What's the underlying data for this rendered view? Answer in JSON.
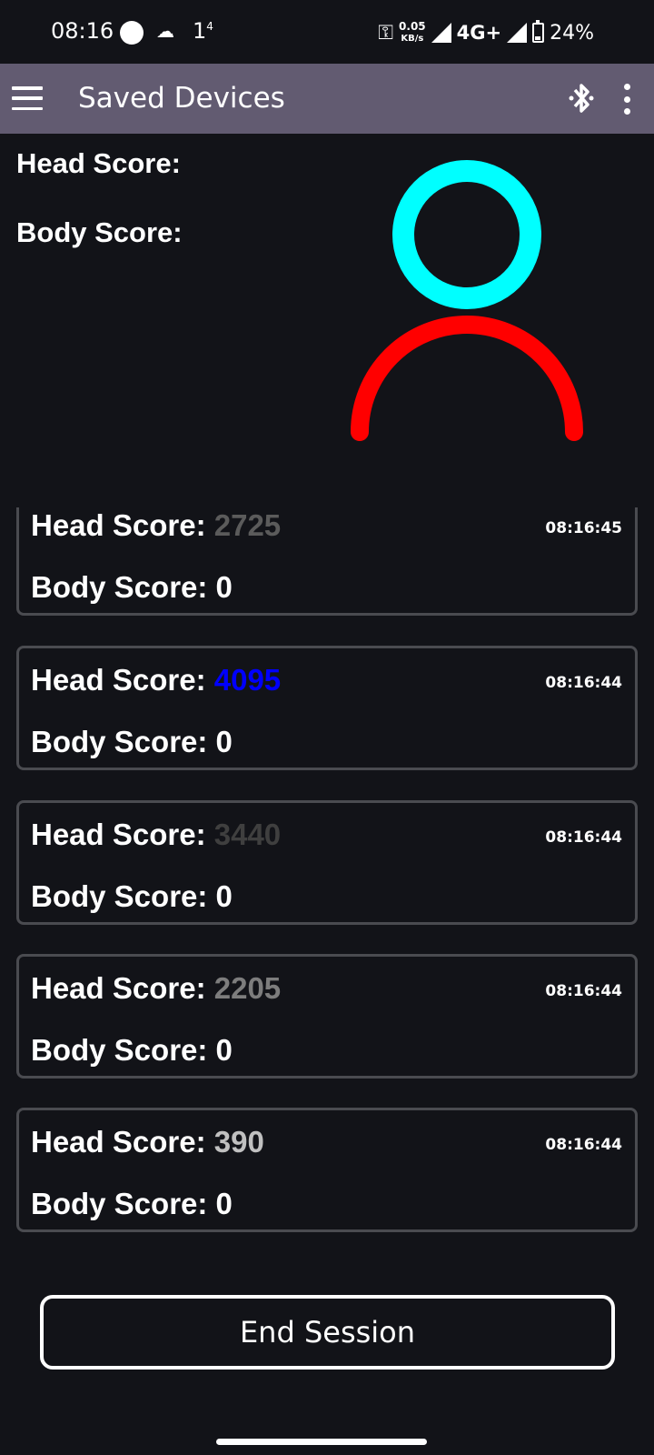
{
  "status_bar": {
    "time": "08:16",
    "notif_text": "1",
    "notif_sup": "4",
    "speed_value": "0.05",
    "speed_unit": "KB/s",
    "network": "4G+",
    "battery": "24%"
  },
  "app_bar": {
    "title": "Saved Devices"
  },
  "live": {
    "head_label": "Head Score:",
    "body_label": "Body Score:",
    "head_color": "#00ffff",
    "body_color": "#ff0000"
  },
  "readings": [
    {
      "head_label": "Head Score:",
      "head_value": "2725",
      "head_color": "#5b5b5b",
      "body_label": "Body Score:",
      "body_value": "0",
      "time": "08:16:45"
    },
    {
      "head_label": "Head Score:",
      "head_value": "4095",
      "head_color": "#0000ff",
      "body_label": "Body Score:",
      "body_value": "0",
      "time": "08:16:44"
    },
    {
      "head_label": "Head Score:",
      "head_value": "3440",
      "head_color": "#3f3f3f",
      "body_label": "Body Score:",
      "body_value": "0",
      "time": "08:16:44"
    },
    {
      "head_label": "Head Score:",
      "head_value": "2205",
      "head_color": "#7d7d7d",
      "body_label": "Body Score:",
      "body_value": "0",
      "time": "08:16:44"
    },
    {
      "head_label": "Head Score:",
      "head_value": "390",
      "head_color": "#c0c0c0",
      "body_label": "Body Score:",
      "body_value": "0",
      "time": "08:16:44"
    }
  ],
  "actions": {
    "end_session": "End Session"
  },
  "icons": {
    "menu": "menu-icon",
    "bluetooth": "bluetooth-icon",
    "more": "more-vert-icon",
    "key": "vpn-key-icon",
    "battery": "battery-icon"
  }
}
